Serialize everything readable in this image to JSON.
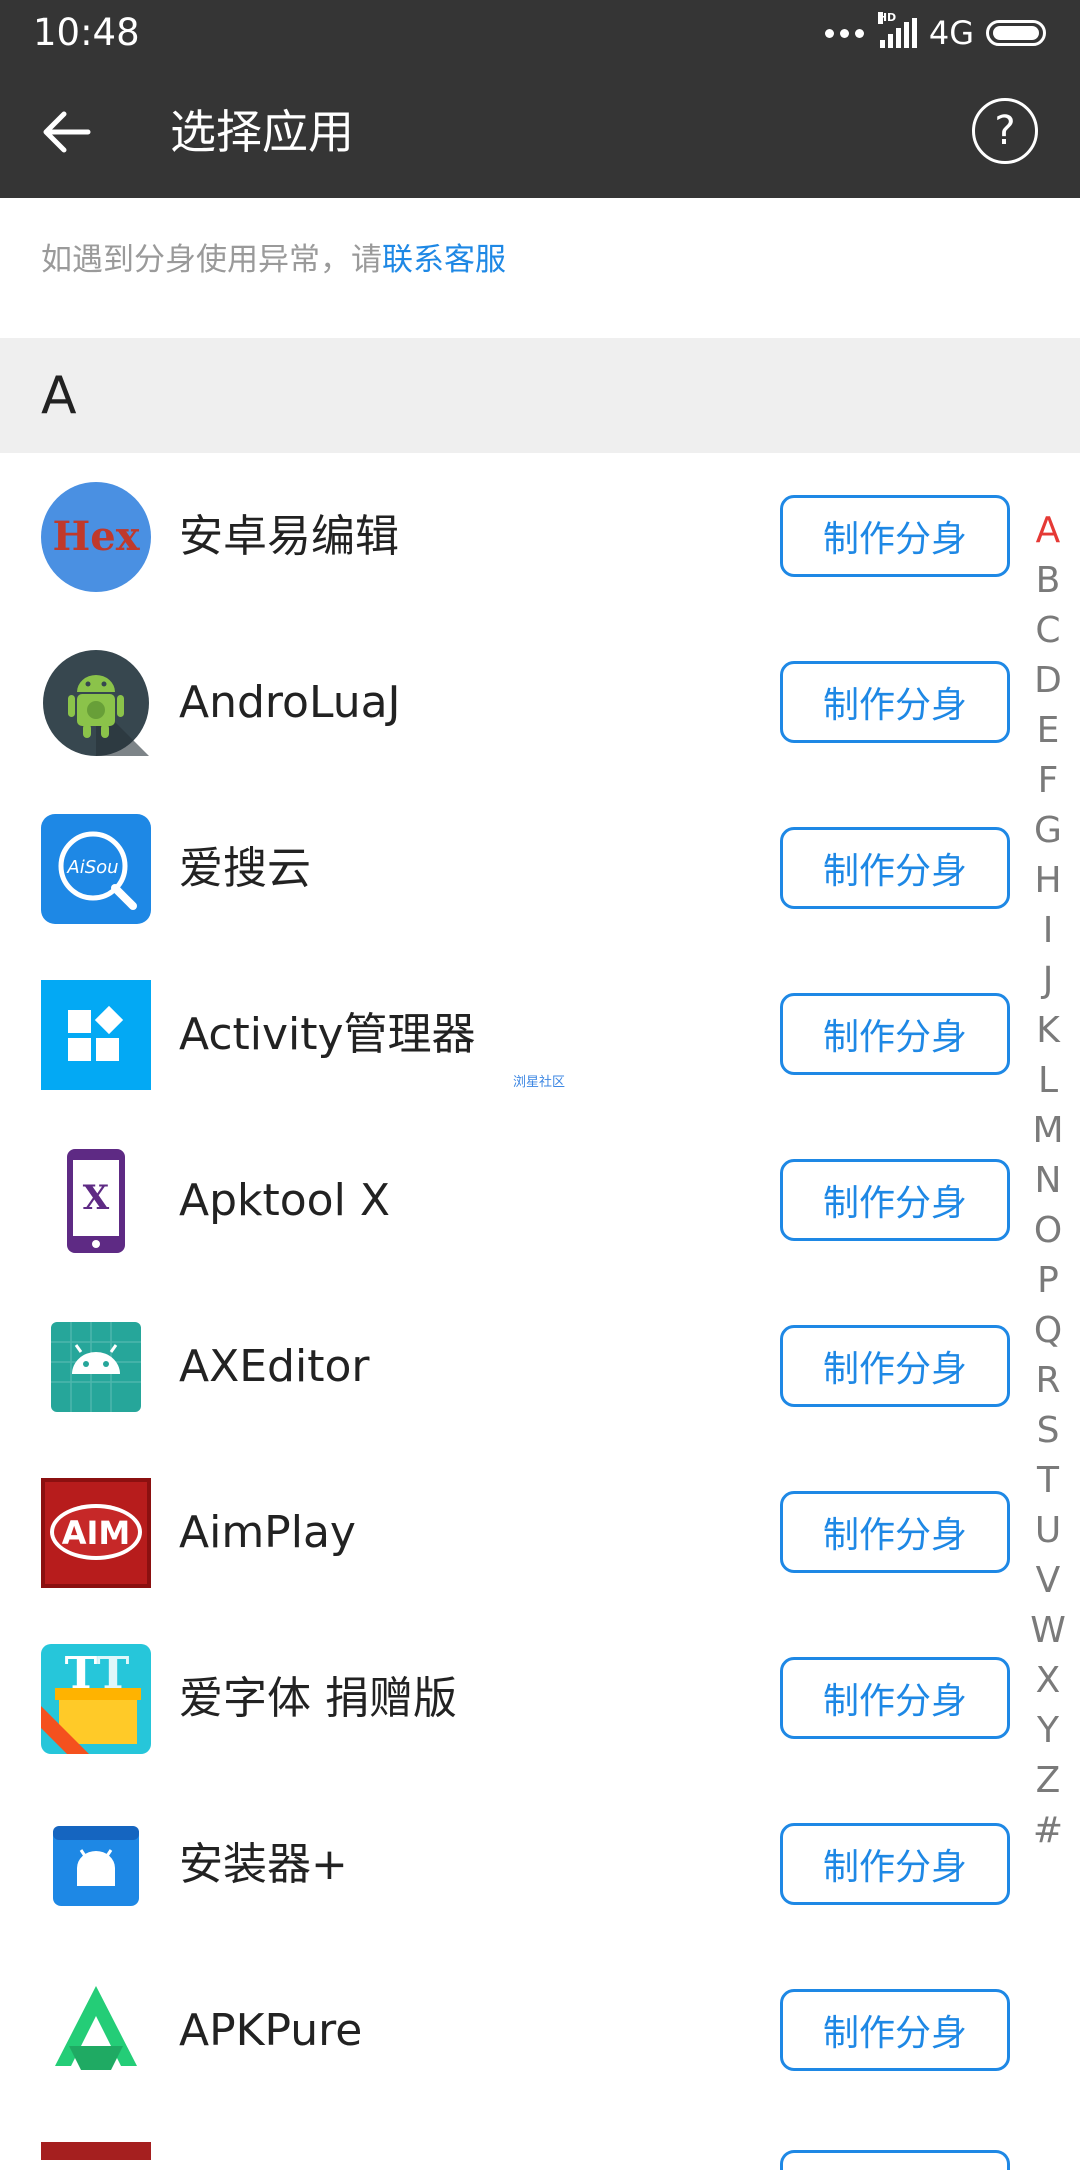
{
  "status": {
    "time": "10:48",
    "hd": "HD",
    "network": "4G"
  },
  "toolbar": {
    "title": "选择应用",
    "help": "?"
  },
  "notice": {
    "text": "如遇到分身使用异常，请",
    "link": "联系客服"
  },
  "section": {
    "letter": "A"
  },
  "clone_label": "制作分身",
  "apps": [
    {
      "name": "安卓易编辑",
      "icon": "hex-editor-icon"
    },
    {
      "name": "AndroLuaJ",
      "icon": "android-robot-icon"
    },
    {
      "name": "爱搜云",
      "icon": "aisou-search-icon"
    },
    {
      "name": "Activity管理器",
      "icon": "activity-grid-icon"
    },
    {
      "name": "Apktool X",
      "icon": "phone-x-icon"
    },
    {
      "name": "AXEditor",
      "icon": "android-grid-icon"
    },
    {
      "name": "AimPlay",
      "icon": "aim-logo-icon"
    },
    {
      "name": "爱字体 捐赠版",
      "icon": "font-donate-icon"
    },
    {
      "name": "安装器+",
      "icon": "installer-icon"
    },
    {
      "name": "APKPure",
      "icon": "apkpure-icon"
    }
  ],
  "watermark": "浏星社区",
  "index_letters": [
    "A",
    "B",
    "C",
    "D",
    "E",
    "F",
    "G",
    "H",
    "I",
    "J",
    "K",
    "L",
    "M",
    "N",
    "O",
    "P",
    "Q",
    "R",
    "S",
    "T",
    "U",
    "V",
    "W",
    "X",
    "Y",
    "Z",
    "#"
  ],
  "active_index": "A",
  "colors": {
    "bar": "#353535",
    "accent": "#1e88e5",
    "active_index": "#e53935",
    "section_bg": "#efefef"
  }
}
